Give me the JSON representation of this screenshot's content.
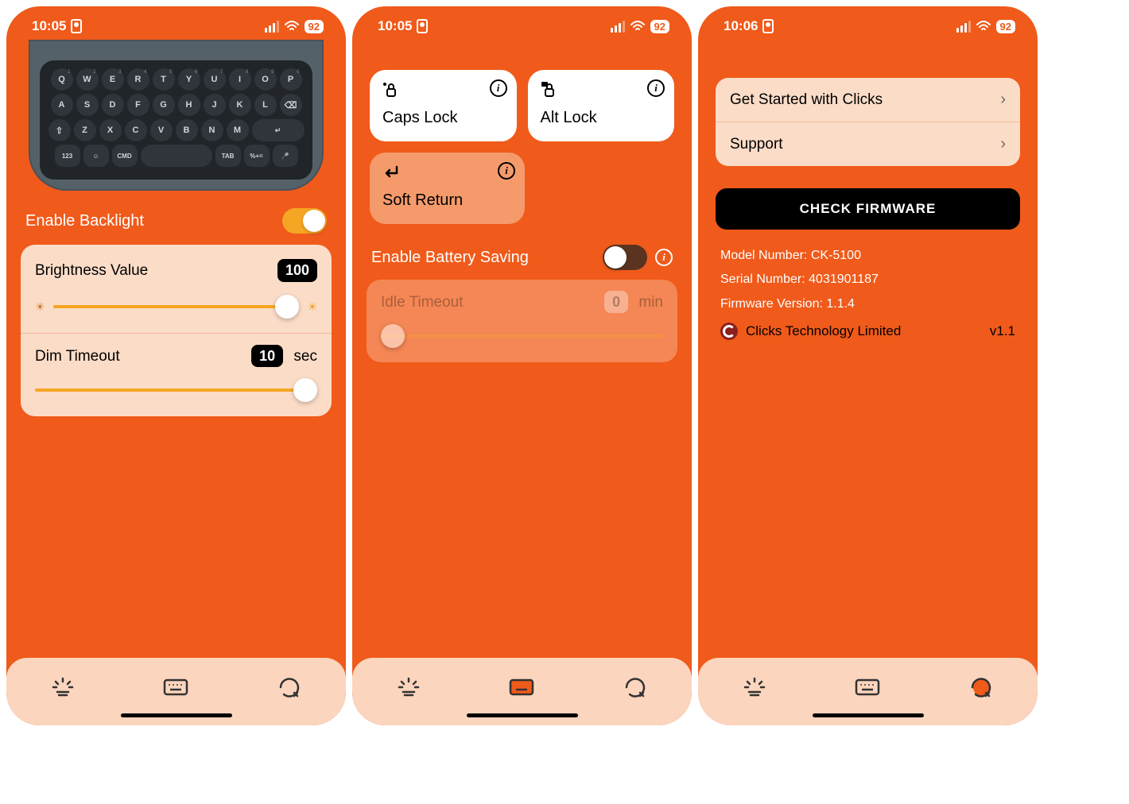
{
  "screens": [
    {
      "time": "10:05",
      "battery": "92",
      "backlight_label": "Enable Backlight",
      "brightness_label": "Brightness Value",
      "brightness_value": "100",
      "dim_label": "Dim Timeout",
      "dim_value": "10",
      "dim_unit": "sec",
      "nav_active": 0
    },
    {
      "time": "10:05",
      "battery": "92",
      "caps_label": "Caps Lock",
      "alt_label": "Alt Lock",
      "soft_label": "Soft Return",
      "battsave_label": "Enable Battery Saving",
      "idle_label": "Idle Timeout",
      "idle_value": "0",
      "idle_unit": "min",
      "nav_active": 1
    },
    {
      "time": "10:06",
      "battery": "92",
      "list_getstarted": "Get Started with Clicks",
      "list_support": "Support",
      "firmware_btn": "CHECK FIRMWARE",
      "model_line": "Model Number: CK-5100",
      "serial_line": "Serial Number: 4031901187",
      "fw_line": "Firmware Version: 1.1.4",
      "brand": "Clicks Technology Limited",
      "version": "v1.1",
      "nav_active": 2
    }
  ],
  "keyboard": {
    "row1": [
      "Q",
      "W",
      "E",
      "R",
      "T",
      "Y",
      "U",
      "I",
      "O",
      "P"
    ],
    "row1_sup": [
      "1",
      "2",
      "3",
      "4",
      "5",
      "6",
      "7",
      "8",
      "9",
      "0"
    ],
    "row2": [
      "A",
      "S",
      "D",
      "F",
      "G",
      "H",
      "J",
      "K",
      "L",
      "⌫"
    ],
    "row3_left": [
      "⇧",
      "Z",
      "X",
      "C",
      "V",
      "B",
      "N",
      "M"
    ],
    "row3_right_label": "↵",
    "row4": [
      "123",
      "☺",
      "CMD",
      "",
      "TAB",
      "%+=",
      "🎤"
    ]
  }
}
